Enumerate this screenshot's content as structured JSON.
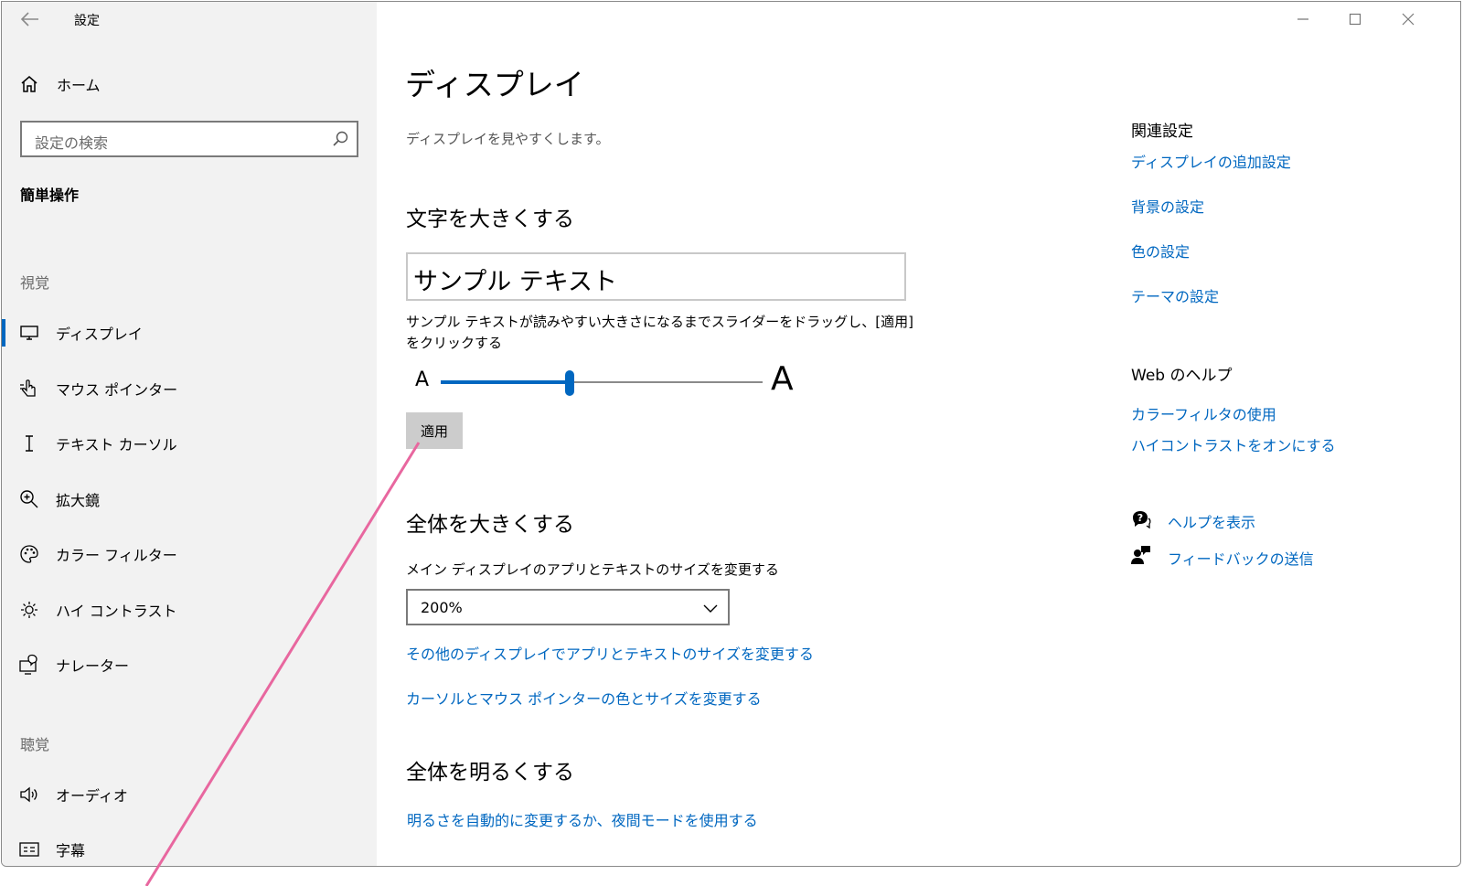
{
  "window": {
    "title": "設定",
    "controls": {
      "minimize": "minimize-icon",
      "maximize": "maximize-icon",
      "close": "close-icon"
    }
  },
  "sidebar": {
    "home_label": "ホーム",
    "search_placeholder": "設定の検索",
    "category": "簡単操作",
    "section_vision": "視覚",
    "section_hearing": "聴覚",
    "items": [
      {
        "label": "ディスプレイ",
        "icon": "monitor-icon",
        "selected": true
      },
      {
        "label": "マウス ポインター",
        "icon": "mouse-pointer-icon"
      },
      {
        "label": "テキスト カーソル",
        "icon": "text-cursor-icon"
      },
      {
        "label": "拡大鏡",
        "icon": "magnifier-icon"
      },
      {
        "label": "カラー フィルター",
        "icon": "palette-icon"
      },
      {
        "label": "ハイ コントラスト",
        "icon": "sun-icon"
      },
      {
        "label": "ナレーター",
        "icon": "narrator-icon"
      }
    ],
    "hearing_items": [
      {
        "label": "オーディオ",
        "icon": "speaker-icon"
      },
      {
        "label": "字幕",
        "icon": "caption-icon"
      }
    ]
  },
  "main": {
    "title": "ディスプレイ",
    "subtitle": "ディスプレイを見やすくします。",
    "text_section": {
      "heading": "文字を大きくする",
      "sample_text": "サンプル テキスト",
      "description": "サンプル テキストが読みやすい大きさになるまでスライダーをドラッグし、[適用] をクリックする",
      "slider_min_label": "A",
      "slider_max_label": "A",
      "slider_value": 0.4,
      "apply_label": "適用"
    },
    "everything_section": {
      "heading": "全体を大きくする",
      "field_label": "メイン ディスプレイのアプリとテキストのサイズを変更する",
      "scale_value": "200%",
      "link_other_displays": "その他のディスプレイでアプリとテキストのサイズを変更する",
      "link_cursor": "カーソルとマウス ポインターの色とサイズを変更する"
    },
    "brightness_section": {
      "heading": "全体を明るくする",
      "link_auto": "明るさを自動的に変更するか、夜間モードを使用する"
    }
  },
  "related": {
    "heading": "関連設定",
    "links": [
      "ディスプレイの追加設定",
      "背景の設定",
      "色の設定",
      "テーマの設定"
    ],
    "web_heading": "Web のヘルプ",
    "web_links": [
      "カラーフィルタの使用",
      "ハイコントラストをオンにする"
    ],
    "help_label": "ヘルプを表示",
    "feedback_label": "フィードバックの送信"
  },
  "colors": {
    "accent": "#0067c0",
    "sidebar_bg": "#f2f2f2",
    "annotation": "#e8679f"
  }
}
